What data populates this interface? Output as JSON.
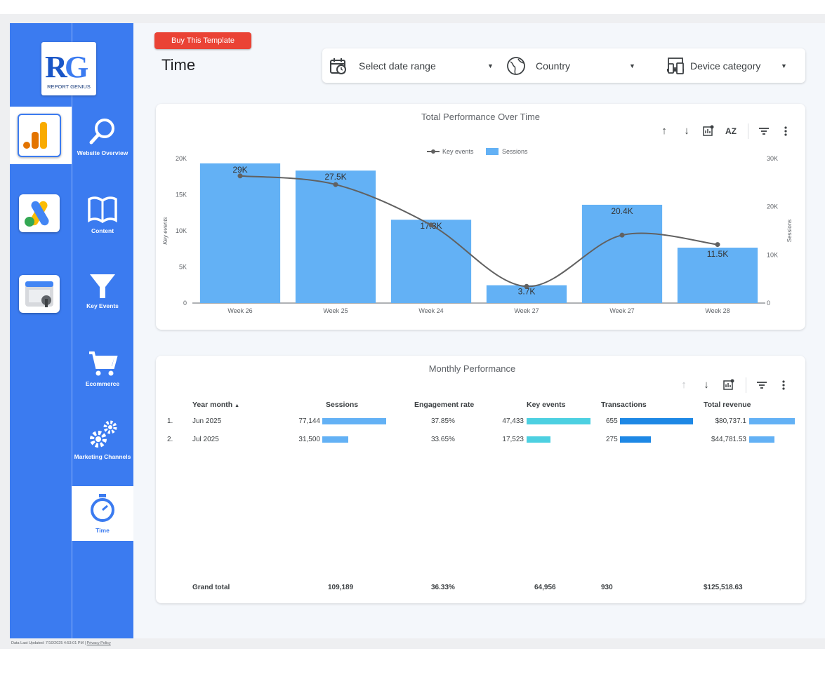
{
  "app": {
    "logo_text": "REPORT GENIUS",
    "buy_button": "Buy This Template",
    "page_title": "Time"
  },
  "sidebar": {
    "apps": [
      {
        "name": "analytics-icon"
      },
      {
        "name": "google-ads-icon"
      },
      {
        "name": "search-console-icon"
      }
    ],
    "nav": [
      {
        "label": "Website Overview",
        "icon": "search-icon"
      },
      {
        "label": "Content",
        "icon": "book-icon"
      },
      {
        "label": "Key Events",
        "icon": "funnel-icon"
      },
      {
        "label": "Ecommerce",
        "icon": "cart-icon"
      },
      {
        "label": "Marketing Channels",
        "icon": "gears-icon"
      },
      {
        "label": "Time",
        "icon": "stopwatch-icon",
        "active": true
      }
    ]
  },
  "filters": {
    "date": "Select date range",
    "country": "Country",
    "device": "Device category"
  },
  "chart_card": {
    "title": "Total Performance Over Time"
  },
  "chart_data": {
    "type": "bar",
    "title": "Total Performance Over Time",
    "categories": [
      "Week 26",
      "Week 25",
      "Week 24",
      "Week 27",
      "Week 27",
      "Week 28"
    ],
    "series": [
      {
        "name": "Sessions",
        "type": "bar",
        "axis": "right",
        "values": [
          29000,
          27500,
          17300,
          3700,
          20400,
          11500
        ],
        "labels": [
          "29K",
          "27.5K",
          "17.3K",
          "3.7K",
          "20.4K",
          "11.5K"
        ],
        "color": "#63b1f5"
      },
      {
        "name": "Key events",
        "type": "line",
        "axis": "left",
        "values": [
          17600,
          16400,
          10800,
          2300,
          9400,
          8100
        ],
        "color": "#616161"
      }
    ],
    "ylabel": "Key events",
    "y2label": "Sessions",
    "ylim": [
      0,
      20000
    ],
    "y2lim": [
      0,
      30000
    ],
    "yticks": [
      "0",
      "5K",
      "10K",
      "15K",
      "20K"
    ],
    "y2ticks": [
      "0",
      "10K",
      "20K",
      "30K"
    ],
    "legend": "top-center"
  },
  "table_card": {
    "title": "Monthly Performance",
    "headers": [
      "Year month",
      "Sessions",
      "Engagement rate",
      "Key events",
      "Transactions",
      "Total revenue"
    ],
    "rows": [
      {
        "idx": "1.",
        "month": "Jun 2025",
        "sessions": "77,144",
        "sessions_frac": 1.0,
        "engagement": "37.85%",
        "key_events": "47,433",
        "key_events_frac": 1.0,
        "transactions": "655",
        "transactions_frac": 1.0,
        "revenue": "$80,737.1",
        "revenue_frac": 1.0
      },
      {
        "idx": "2.",
        "month": "Jul 2025",
        "sessions": "31,500",
        "sessions_frac": 0.408,
        "engagement": "33.65%",
        "key_events": "17,523",
        "key_events_frac": 0.369,
        "transactions": "275",
        "transactions_frac": 0.42,
        "revenue": "$44,781.53",
        "revenue_frac": 0.555
      }
    ],
    "grand_total": {
      "label": "Grand total",
      "sessions": "109,189",
      "engagement": "36.33%",
      "key_events": "64,956",
      "transactions": "930",
      "revenue": "$125,518.63"
    },
    "colors": {
      "sessions": "#63b1f5",
      "key_events": "#4dd0e1",
      "transactions": "#1e88e5",
      "revenue": "#63b1f5"
    }
  },
  "footer": {
    "updated": "Data Last Updated: 7/10/2025 4:53:01 PM",
    "separator": "|",
    "privacy": "Privacy Policy"
  }
}
